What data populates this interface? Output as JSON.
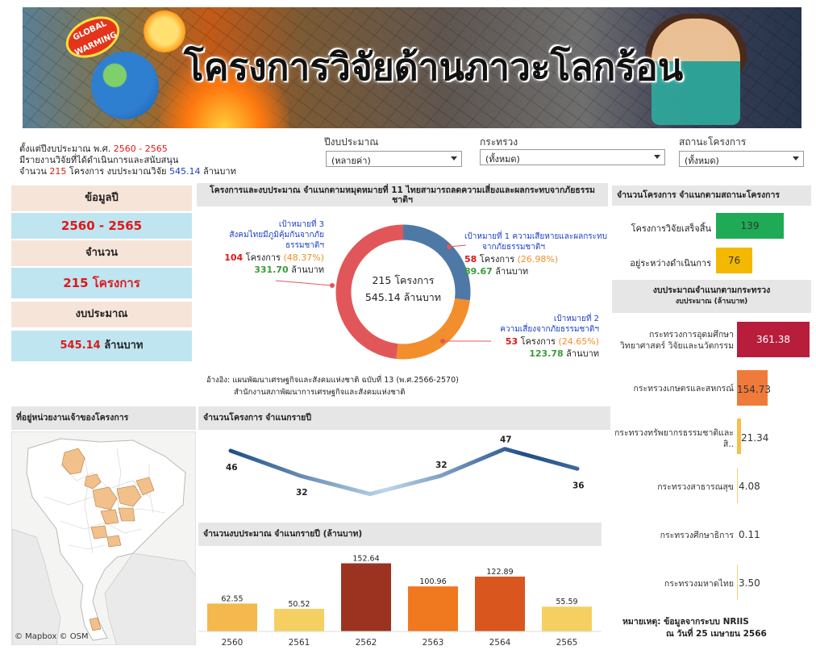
{
  "banner": {
    "title": "โครงการวิจัยด้านภาวะโลกร้อน",
    "badge": "GLOBAL WARMING"
  },
  "intro": {
    "line1_prefix": "ตั้งแต่ปีงบประมาณ พ.ศ. ",
    "line1_range": "2560 - 2565",
    "line2": "มีรายงานวิจัยที่ได้ดำเนินการและสนับสนุน",
    "line3_prefix": "จำนวน ",
    "line3_count": "215",
    "line3_mid": " โครงการ งบประมาณวิจัย ",
    "line3_budget": "545.14",
    "line3_suffix": " ล้านบาท"
  },
  "filters": {
    "year": {
      "label": "ปีงบประมาณ",
      "value": "(หลายค่า)"
    },
    "ministry": {
      "label": "กระทรวง",
      "value": "(ทั้งหมด)"
    },
    "status": {
      "label": "สถานะโครงการ",
      "value": "(ทั้งหมด)"
    }
  },
  "summary": {
    "header_year": "ข้อมูลปี",
    "year_range": "2560 - 2565",
    "header_count": "จำนวน",
    "count": "215 โครงการ",
    "header_budget": "งบประมาณ",
    "budget_value": "545.14",
    "budget_unit": " ล้านบาท"
  },
  "donut": {
    "header": "โครงการและงบประมาณ จำแนกตามหมุดหมายที่ 11 ไทยสามารถลดความเสี่ยงและผลกระทบจากภัยธรรมชาติฯ",
    "center_line1": "215 โครงการ",
    "center_line2": "545.14 ล้านบาท",
    "goal3": {
      "title1": "เป้าหมายที่ 3",
      "title2": "สังคมไทยมีภูมิคุ้มกันจากภัยธรรมชาติฯ",
      "count": "104",
      "count_label": " โครงการ ",
      "pct": "(48.37%)",
      "budget": "331.70",
      "budget_unit": " ล้านบาท"
    },
    "goal1": {
      "title1": "เป้าหมายที่ 1 ความเสียหายและผลกระทบ",
      "title2": "จากภัยธรรมชาติฯ",
      "count": "58",
      "count_label": " โครงการ ",
      "pct": "(26.98%)",
      "budget": "89.67",
      "budget_unit": " ล้านบาท"
    },
    "goal2": {
      "title1": "เป้าหมายที่ 2",
      "title2": "ความเสี่ยงจากภัยธรรมชาติฯ",
      "count": "53",
      "count_label": " โครงการ ",
      "pct": "(24.65%)",
      "budget": "123.78",
      "budget_unit": " ล้านบาท"
    },
    "colors": {
      "goal1": "#4e79a7",
      "goal2": "#f28e2b",
      "goal3": "#e15759"
    },
    "reference1": "อ้างอิง: แผนพัฒนาเศรษฐกิจและสังคมแห่งชาติ ฉบับที่ 13 (พ.ศ.2566-2570)",
    "reference2": "สำนักงานสภาพัฒนาการเศรษฐกิจและสังคมแห่งชาติ"
  },
  "status_panel": {
    "header": "จำนวนโครงการ จำแนกตามสถานะโครงการ",
    "items": [
      {
        "label": "โครงการวิจัยเสร็จสิ้น",
        "value": "139",
        "color": "#1faa55"
      },
      {
        "label": "อยู่ระหว่างดำเนินการ",
        "value": "76",
        "color": "#f5b800"
      }
    ]
  },
  "ministry_panel": {
    "header1": "งบประมาณจำแนกตามกระทรวง",
    "header2": "งบประมาณ (ล้านบาท)",
    "items": [
      {
        "label": "กระทรวงการอุดมศึกษา วิทยาศาสตร์ วิจัยและนวัตกรรม",
        "value": "361.38",
        "color": "#b81d3c"
      },
      {
        "label": "กระทรวงเกษตรและสหกรณ์",
        "value": "154.73",
        "color": "#f07a3a"
      },
      {
        "label": "กระทรวงทรัพยากรธรรมชาติและสิ..",
        "value": "21.34",
        "color": "#f5c04a"
      },
      {
        "label": "กระทรวงสาธารณสุข",
        "value": "4.08",
        "color": "#f5d170"
      },
      {
        "label": "กระทรวงศึกษาธิการ",
        "value": "0.11",
        "color": "#f7dc8a"
      },
      {
        "label": "กระทรวงมหาดไทย",
        "value": "3.50",
        "color": "#f5d170"
      }
    ],
    "note1": "หมายเหตุ: ข้อมูลจากระบบ NRIIS",
    "note2": "ณ วันที่ 25 เมษายน 2566"
  },
  "map_panel": {
    "header": "ที่อยู่หน่วยงานเจ้าของโครงการ",
    "attribution": "© Mapbox  © OSM",
    "highlight_color": "#f2c08a"
  },
  "chart_data": [
    {
      "type": "line",
      "title": "จำนวนโครงการ จำแนกรายปี",
      "x": [
        "2560",
        "2561",
        "2562",
        "2563",
        "2564",
        "2565"
      ],
      "values": [
        46,
        32,
        22,
        32,
        47,
        36
      ],
      "labels": [
        "46",
        "32",
        "",
        "32",
        "47",
        "36"
      ],
      "color_start": "#1f4e87",
      "color_end": "#bcd6ea"
    },
    {
      "type": "bar",
      "title": "จำนวนงบประมาณ จำแนกรายปี (ล้านบาท)",
      "categories": [
        "2560",
        "2561",
        "2562",
        "2563",
        "2564",
        "2565"
      ],
      "values": [
        62.55,
        50.52,
        152.64,
        100.96,
        122.89,
        55.59
      ],
      "colors": [
        "#f5b84e",
        "#f5cf62",
        "#9b3320",
        "#f0781f",
        "#d9561e",
        "#f5cf62"
      ]
    }
  ]
}
